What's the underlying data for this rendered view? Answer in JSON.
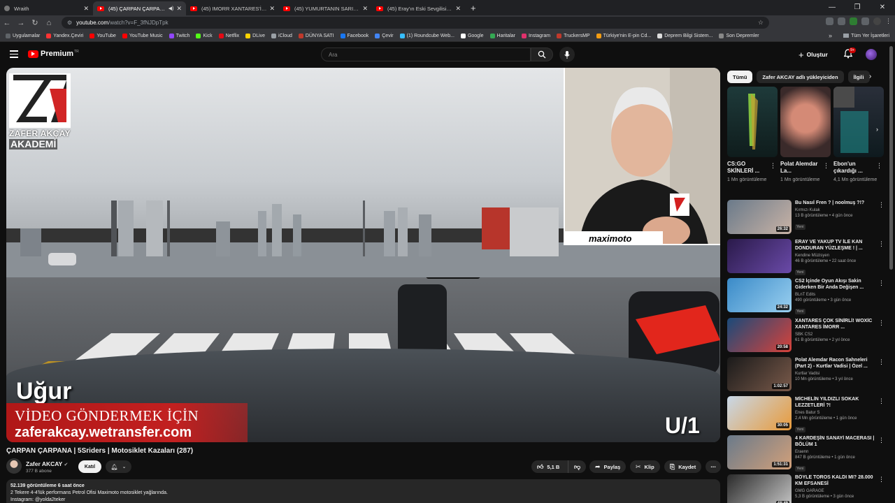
{
  "browser": {
    "tabs": [
      {
        "title": "Wraith",
        "icon": "wraith-icon"
      },
      {
        "title": "(45) ÇARPAN ÇARPANA | 5S",
        "icon": "youtube-icon",
        "active": true
      },
      {
        "title": "(45) IMORR XANTARES'İ TROLL",
        "icon": "youtube-icon"
      },
      {
        "title": "(45) YUMURTANIN SARISI - Yo",
        "icon": "youtube-icon"
      },
      {
        "title": "(45) Eray'ın Eski Sevgilisi Chatt",
        "icon": "youtube-icon"
      }
    ],
    "new_tab": "+",
    "url_host": "youtube.com",
    "url_path": "/watch?v=F_3fNJDpTpk",
    "bookmarks": [
      {
        "label": "Uygulamalar",
        "color": "#5f6368"
      },
      {
        "label": "Yandex.Çeviri",
        "color": "#ff3333"
      },
      {
        "label": "YouTube",
        "color": "#ff0000"
      },
      {
        "label": "YouTube Music",
        "color": "#ff0000"
      },
      {
        "label": "Twitch",
        "color": "#9146ff"
      },
      {
        "label": "Kick",
        "color": "#53fc18"
      },
      {
        "label": "Netflix",
        "color": "#e50914"
      },
      {
        "label": "DLive",
        "color": "#ffd300"
      },
      {
        "label": "iCloud",
        "color": "#9aa0a6"
      },
      {
        "label": "DÜNYA SATI",
        "color": "#c0392b"
      },
      {
        "label": "Facebook",
        "color": "#1877f2"
      },
      {
        "label": "Çevir",
        "color": "#4285f4"
      },
      {
        "label": "(1) Roundcube Web...",
        "color": "#37beff"
      },
      {
        "label": "Google",
        "color": "#ffffff"
      },
      {
        "label": "Haritalar",
        "color": "#34a853"
      },
      {
        "label": "Instagram",
        "color": "#e1306c"
      },
      {
        "label": "TruckersMP",
        "color": "#c0392b"
      },
      {
        "label": "Türkiye'nin E-pin Cd...",
        "color": "#f39c12"
      },
      {
        "label": "Deprem Bilgi Sistem...",
        "color": "#dddddd"
      },
      {
        "label": "Son Depremler",
        "color": "#888888"
      }
    ],
    "other_bookmarks": "Tüm Yer İşaretleri"
  },
  "youtube": {
    "logo_word": "Premium",
    "logo_tr": "TR",
    "search_placeholder": "Ara",
    "create_label": "Oluştur",
    "notif_badge": "9+"
  },
  "video": {
    "title": "ÇARPAN ÇARPANA | 5Sriders | Motosiklet Kazaları (287)",
    "overlay_logo_line1": "ZAFER AKÇAY",
    "overlay_logo_line2": "AKADEMİ",
    "overlay_name": "Uğur",
    "overlay_send": "VİDEO GÖNDERMEK İÇİN",
    "overlay_url": "zaferakcay.wetransfer.com",
    "overlay_counter": "U/1",
    "sponsor": "maximoto"
  },
  "channel": {
    "name": "Zafer AKCAY",
    "subs": "377 B abone",
    "join": "Katıl"
  },
  "actions": {
    "likes": "5,1 B",
    "share": "Paylaş",
    "clip": "Klip",
    "save": "Kaydet"
  },
  "description": {
    "meta": "52.139 görüntüleme  6 saat önce",
    "line1": "2 Tekere 4-4'lük performans Petrol Ofisi Maximoto motosiklet yağlarında.",
    "line2": "Instagram: @yolda2teker"
  },
  "sidebar": {
    "chips": [
      "Tümü",
      "Zafer AKCAY adlı yükleyiciden",
      "İlgili"
    ],
    "shorts": [
      {
        "title": "CS:GO SKİNLERİ ...",
        "views": "1 Mn görüntüleme"
      },
      {
        "title": "Polat Alemdar La...",
        "views": "1 Mn görüntüleme"
      },
      {
        "title": "Ebon'un çıkardığı ...",
        "views": "4,1 Mn görüntüleme"
      }
    ],
    "recs": [
      {
        "title": "Bu Nasıl Fren ? | noolmuş ?!?",
        "channel": "Kırmızı Kulak",
        "views": "13 B görüntüleme • 4 gün önce",
        "badge": "Yeni",
        "duration": "26:32"
      },
      {
        "title": "ERAY VE YAKUP TV İLE KAN DONDURAN YÜZLEŞME ! | ...",
        "channel": "Kendine Müzisyen",
        "views": "46 B görüntüleme • 22 saat önce",
        "badge": "Yeni",
        "duration": ""
      },
      {
        "title": "CS2 İçinde Oyun Akışı Sakin Giderken Bir Anda Değişen ...",
        "channel": "BLnT Edits",
        "views": "490 görüntüleme • 3 gün önce",
        "badge": "Yeni",
        "duration": "24:32"
      },
      {
        "title": "XANTARES ÇOK SİNİRLİ! WOXİC XANTARES İMORR ...",
        "channel": "SBK CS2",
        "views": "61 B görüntüleme • 2 yıl önce",
        "badge": "",
        "duration": "20:58"
      },
      {
        "title": "Polat Alemdar Racon Sahneleri (Part 2) - Kurtlar Vadisi | Özel ...",
        "channel": "Kurtlar Vadisi",
        "views": "10 Mn görüntüleme • 3 yıl önce",
        "badge": "",
        "duration": "1:02:57"
      },
      {
        "title": "MİCHELİN YILDIZLI SOKAK LEZZETLERİ ?!",
        "channel": "Enes Batur S",
        "views": "2,4 Mn görüntüleme • 1 gün önce",
        "badge": "Yeni",
        "duration": "30:05"
      },
      {
        "title": "4 KARDEŞİN SANAYİ MACERASI | BÖLÜM 1",
        "channel": "Eraenn",
        "views": "847 B görüntüleme • 1 gün önce",
        "badge": "Yeni",
        "duration": "1:51:31"
      },
      {
        "title": "BÖYLE TOROS KALDI MI? 28.000 KM EFSANESİ",
        "channel": "GMG GARAGE",
        "views": "5,3 B görüntüleme • 3 gün önce",
        "badge": "Yeni",
        "duration": "48:49"
      }
    ]
  }
}
